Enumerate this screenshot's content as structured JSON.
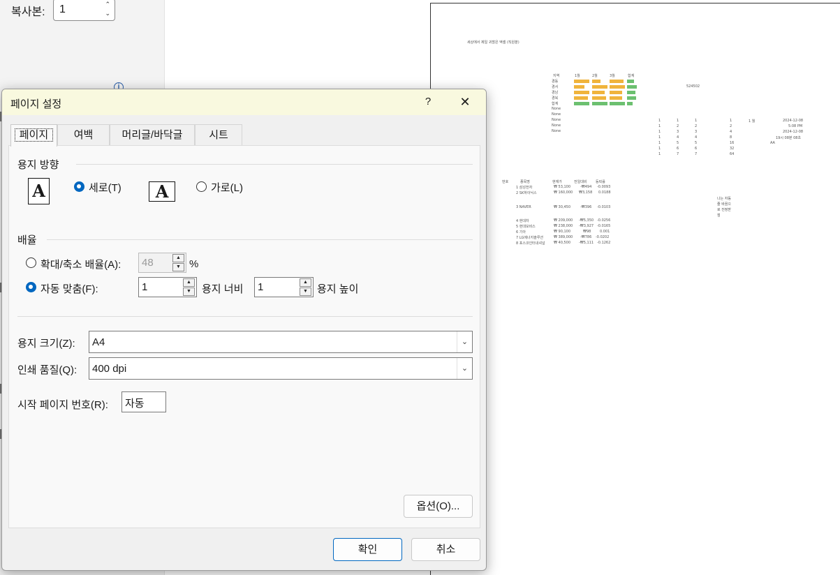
{
  "backstage": {
    "copies_label": "복사본:",
    "copies_value": "1"
  },
  "preview": {
    "title": "세상에서 제일 귀찮은 엑셀 (직원분)",
    "table1_header": [
      "지역",
      "1월",
      "2월",
      "3월",
      "합계"
    ],
    "table1_regions": [
      "경동",
      "경서",
      "경남",
      "경북",
      "합계",
      "None",
      "None",
      "None",
      "None",
      "None"
    ],
    "side_value": "524502",
    "right_dates": [
      "2024-12-08",
      "5:08 PM",
      "2024-12-08",
      "19시 08분 08초"
    ],
    "right_label": "1 월",
    "letter_a": "AA",
    "stock_header": [
      "번호",
      "종목명",
      "현재가",
      "전일대비",
      "등락률"
    ],
    "stock_names": [
      "1 삼성전자",
      "2 SK하이닉스",
      "3 NAVER",
      "4 현대차",
      "5 현대모비스",
      "6 기아",
      "7 LG에너지솔루션",
      "8 포스코인터내셔널"
    ],
    "note_text": [
      "나는 자동",
      "줄 바꿈으",
      "로 전정받",
      "점"
    ]
  },
  "dialog": {
    "title": "페이지 설정",
    "help": "?",
    "tabs": [
      "페이지",
      "여백",
      "머리글/바닥글",
      "시트"
    ],
    "orientation": {
      "group_label": "용지 방향",
      "portrait_label": "세로(T)",
      "landscape_label": "가로(L)",
      "selected": "portrait"
    },
    "scaling": {
      "group_label": "배율",
      "adjust_label": "확대/축소 배율(A):",
      "adjust_value": "48",
      "percent": "%",
      "fit_label": "자동 맞춤(F):",
      "fit_wide": "1",
      "wide_label": "용지 너비",
      "fit_tall": "1",
      "tall_label": "용지 높이",
      "selected": "fit"
    },
    "paper_size_label": "용지 크기(Z):",
    "paper_size_value": "A4",
    "print_quality_label": "인쇄 품질(Q):",
    "print_quality_value": "400 dpi",
    "first_page_label": "시작 페이지 번호(R):",
    "first_page_value": "자동",
    "options_button": "옵션(O)...",
    "ok_button": "확인",
    "cancel_button": "취소"
  },
  "colors": {
    "accent": "#0067c0",
    "title_bar": "#f9f9df",
    "bar_orange": "#f0b43c",
    "bar_green": "#6cc070"
  }
}
